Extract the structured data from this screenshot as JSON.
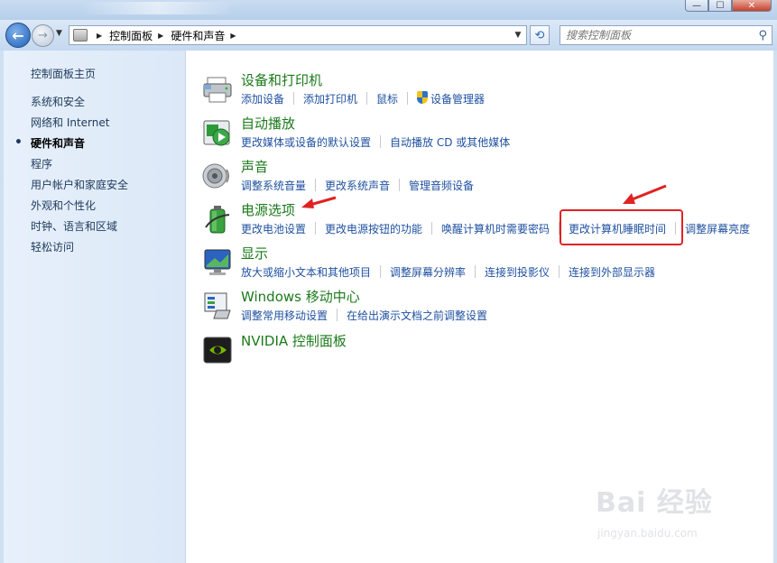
{
  "window": {
    "minimize_label": "—",
    "maximize_label": "☐",
    "close_label": "✕"
  },
  "nav": {
    "back_label": "←",
    "forward_label": "→",
    "breadcrumb": [
      "控制面板",
      "硬件和声音"
    ],
    "search_placeholder": "搜索控制面板"
  },
  "sidebar": {
    "home": "控制面板主页",
    "items": [
      {
        "label": "系统和安全",
        "current": false
      },
      {
        "label": "网络和 Internet",
        "current": false
      },
      {
        "label": "硬件和声音",
        "current": true
      },
      {
        "label": "程序",
        "current": false
      },
      {
        "label": "用户帐户和家庭安全",
        "current": false
      },
      {
        "label": "外观和个性化",
        "current": false
      },
      {
        "label": "时钟、语言和区域",
        "current": false
      },
      {
        "label": "轻松访问",
        "current": false
      }
    ]
  },
  "categories": [
    {
      "title": "设备和打印机",
      "icon": "printer-icon",
      "links": [
        "添加设备",
        "添加打印机",
        "鼠标",
        "设备管理器"
      ]
    },
    {
      "title": "自动播放",
      "icon": "autoplay-icon",
      "links": [
        "更改媒体或设备的默认设置",
        "自动播放 CD 或其他媒体"
      ]
    },
    {
      "title": "声音",
      "icon": "speaker-icon",
      "links": [
        "调整系统音量",
        "更改系统声音",
        "管理音频设备"
      ]
    },
    {
      "title": "电源选项",
      "icon": "battery-icon",
      "links": [
        "更改电池设置",
        "更改电源按钮的功能",
        "唤醒计算机时需要密码",
        "更改计算机睡眠时间",
        "调整屏幕亮度"
      ]
    },
    {
      "title": "显示",
      "icon": "monitor-icon",
      "links": [
        "放大或缩小文本和其他项目",
        "调整屏幕分辨率",
        "连接到投影仪",
        "连接到外部显示器"
      ]
    },
    {
      "title": "Windows 移动中心",
      "icon": "mobility-center-icon",
      "links": [
        "调整常用移动设置",
        "在给出演示文档之前调整设置"
      ]
    },
    {
      "title": "NVIDIA 控制面板",
      "icon": "nvidia-icon",
      "links": []
    }
  ],
  "watermark": {
    "brand": "Bai 经验",
    "url": "jingyan.baidu.com"
  },
  "colors": {
    "category_title": "#1b7a1b",
    "link": "#1f51a0",
    "annotation_red": "#e02222"
  }
}
